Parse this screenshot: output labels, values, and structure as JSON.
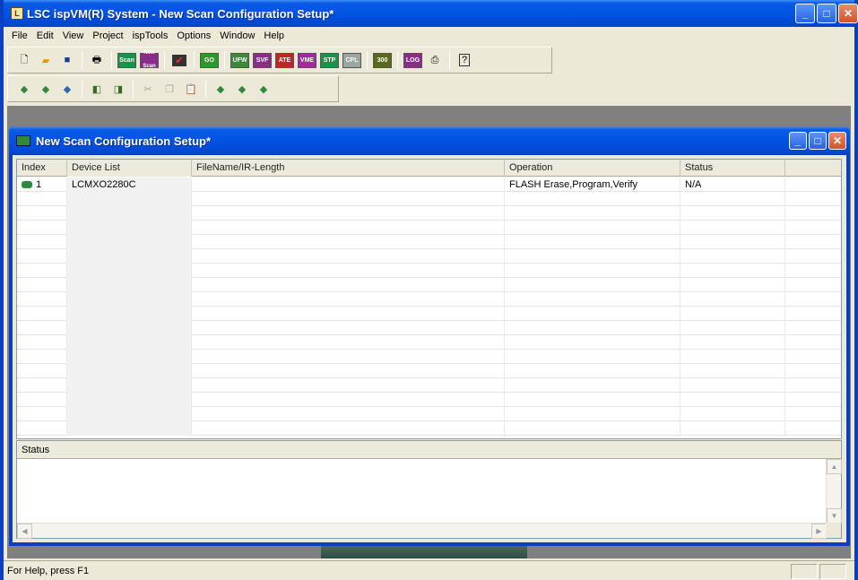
{
  "window": {
    "title": "LSC ispVM(R) System - New Scan Configuration Setup*",
    "app_icon_text": "L"
  },
  "menu": [
    "File",
    "Edit",
    "View",
    "Project",
    "ispTools",
    "Options",
    "Window",
    "Help"
  ],
  "toolbar1": {
    "labeled_buttons": [
      "Scan",
      "New Scan",
      "GO",
      "UFW",
      "SVF",
      "ATE",
      "VME",
      "STP",
      "CPL",
      "300",
      "LOG"
    ]
  },
  "child_window": {
    "title": "New Scan Configuration Setup*"
  },
  "table": {
    "columns": [
      "Index",
      "Device List",
      "FileName/IR-Length",
      "Operation",
      "Status"
    ],
    "rows": [
      {
        "index": "1",
        "device": "LCMXO2280C",
        "filename": "",
        "operation": "FLASH Erase,Program,Verify",
        "status": "N/A"
      }
    ]
  },
  "status_pane": {
    "header": "Status"
  },
  "statusbar": {
    "help_text": "For Help, press F1"
  },
  "colors": {
    "titlebar_blue": "#0054e3",
    "face": "#ece9d8",
    "close_red": "#d2512a"
  }
}
